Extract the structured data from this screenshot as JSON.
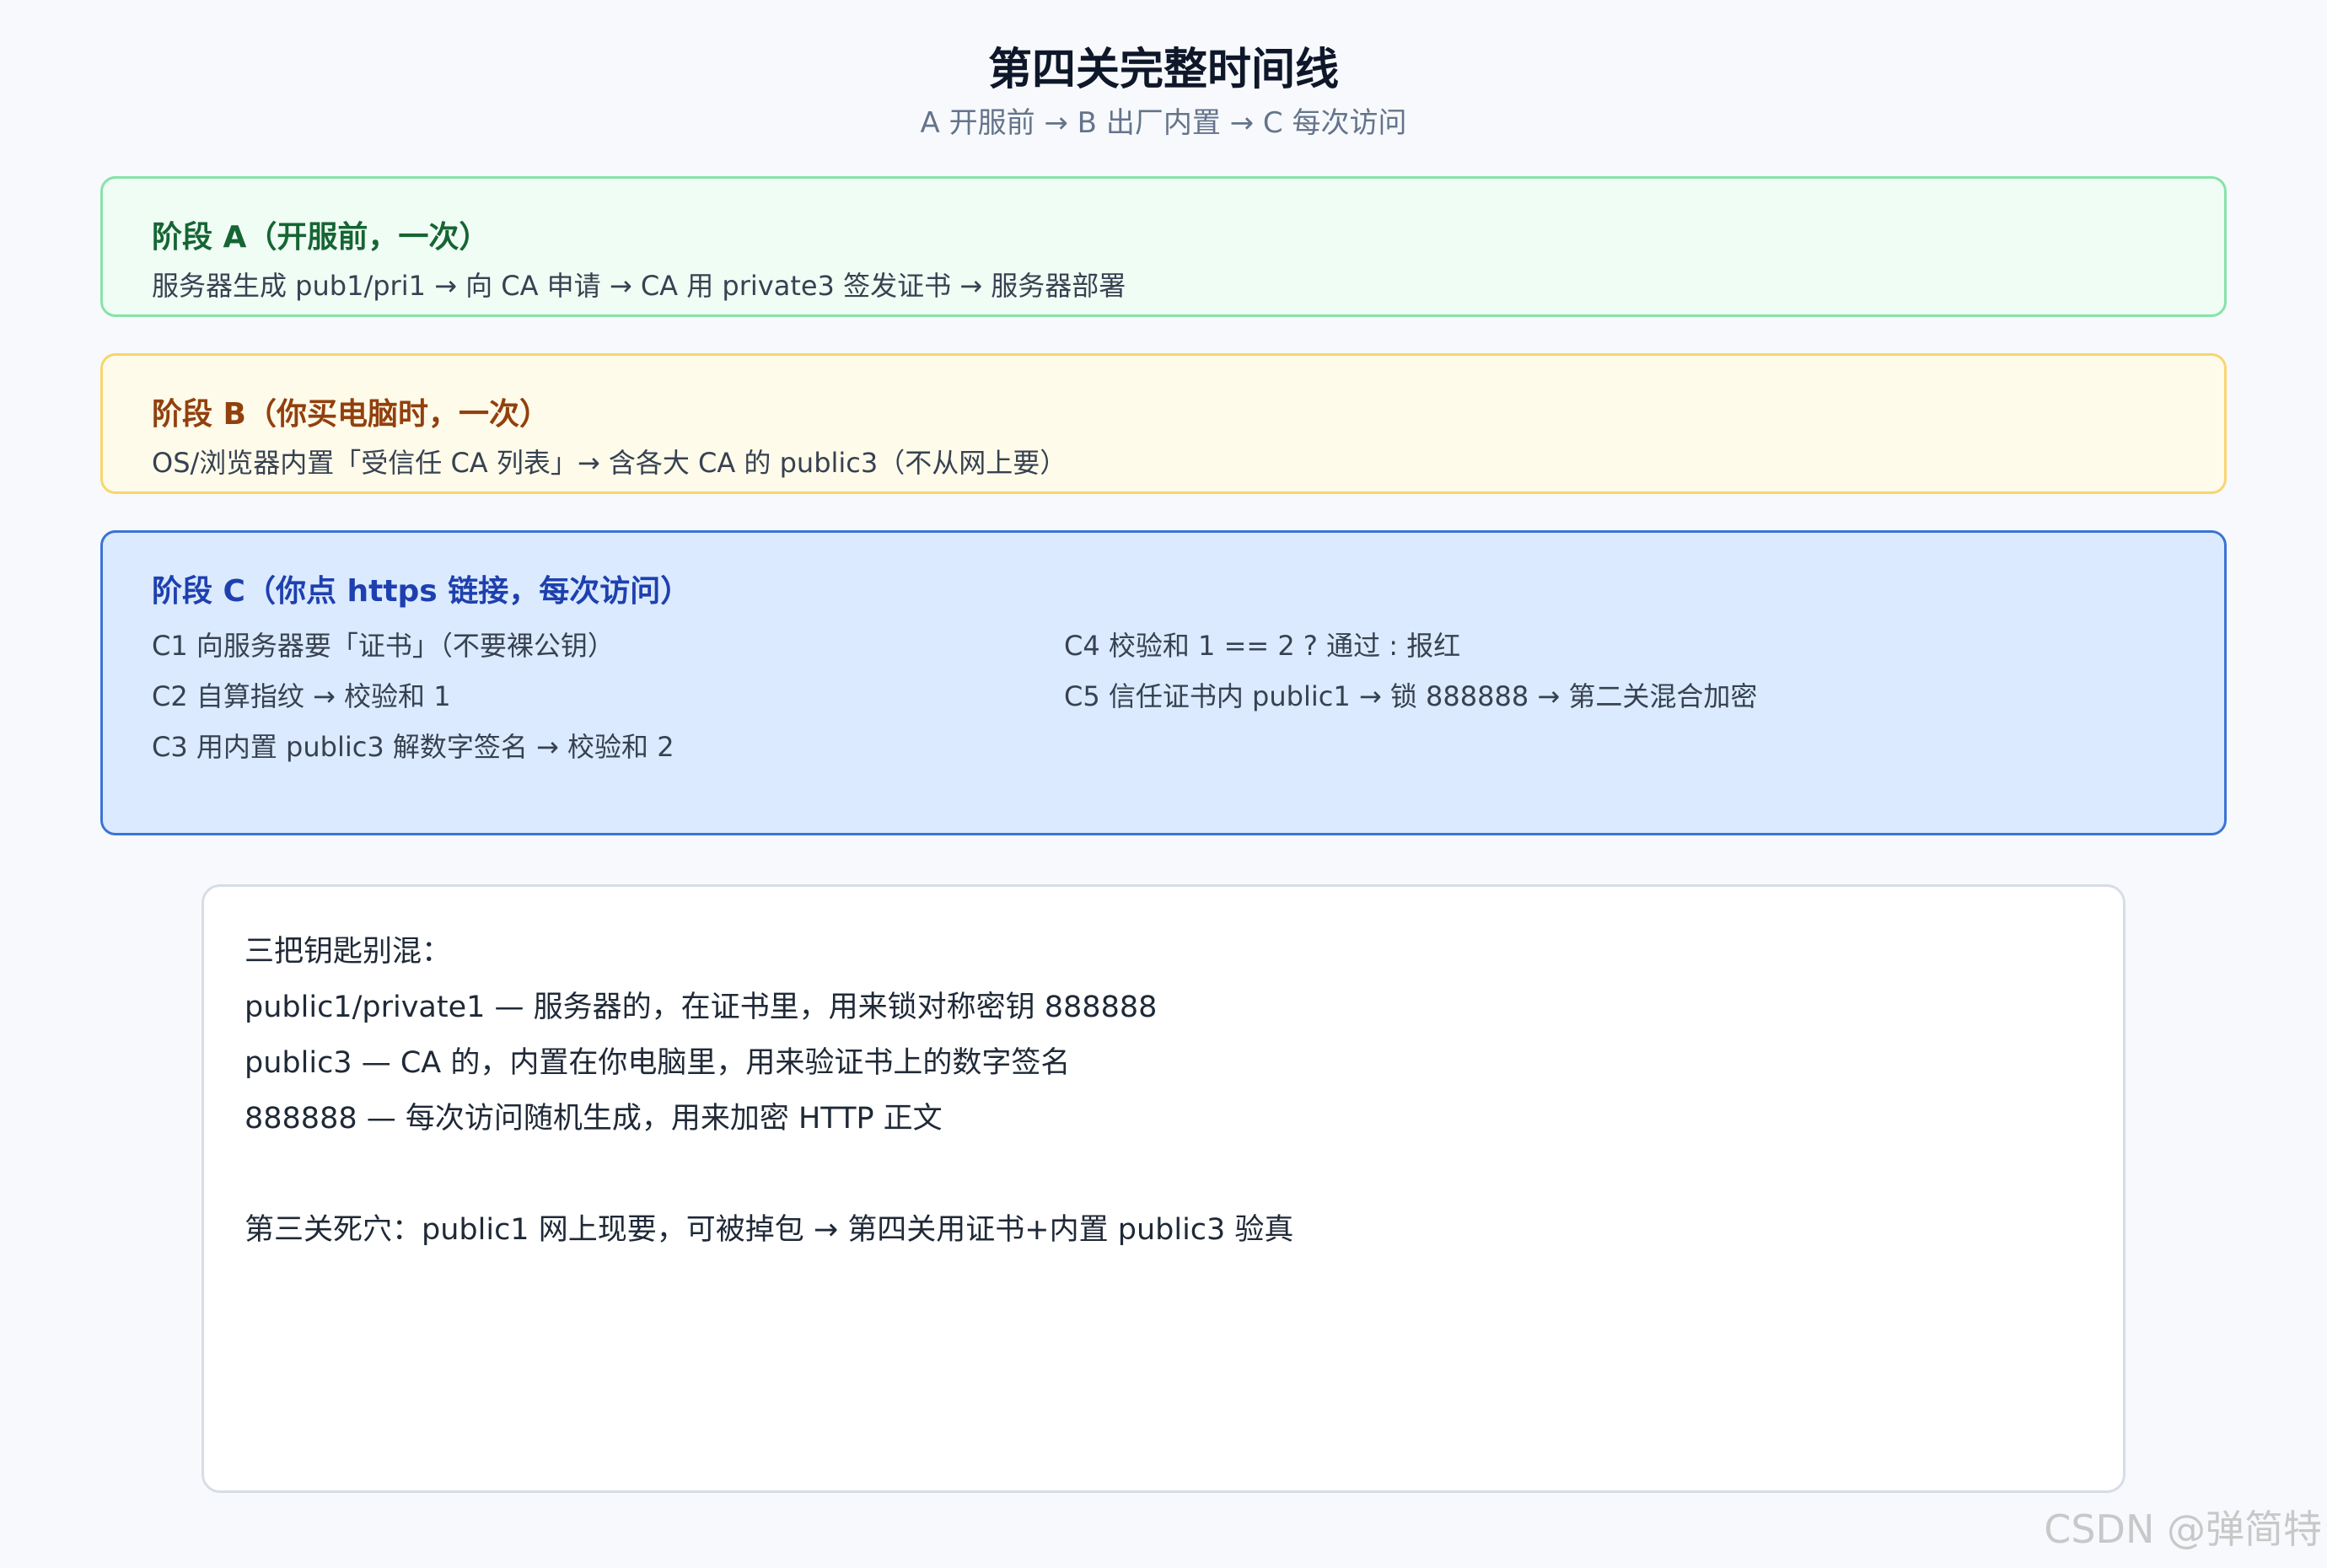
{
  "header": {
    "title": "第四关完整时间线",
    "subtitle": "A 开服前 → B 出厂内置 → C 每次访问"
  },
  "stages": {
    "a": {
      "title": "阶段 A（开服前，一次）",
      "description": "服务器生成 pub1/pri1 → 向 CA 申请 → CA 用 private3 签发证书 → 服务器部署"
    },
    "b": {
      "title": "阶段 B（你买电脑时，一次）",
      "description": "OS/浏览器内置「受信任 CA 列表」→ 含各大 CA 的 public3（不从网上要）"
    },
    "c": {
      "title": "阶段 C（你点 https 链接，每次访问）",
      "steps": [
        "C1 向服务器要「证书」（不要裸公钥）",
        "C2 自算指纹 → 校验和 1",
        "C3 用内置 public3 解数字签名 → 校验和 2",
        "C4 校验和 1 == 2 ? 通过 : 报红",
        "C5 信任证书内 public1 → 锁 888888 → 第二关混合加密"
      ]
    }
  },
  "keys_note": {
    "lines": [
      "三把钥匙别混：",
      "public1/private1 — 服务器的，在证书里，用来锁对称密钥 888888",
      "public3 — CA 的，内置在你电脑里，用来验证书上的数字签名",
      "888888 — 每次访问随机生成，用来加密 HTTP 正文",
      "第三关死穴：public1 网上现要，可被掉包 → 第四关用证书+内置 public3 验真"
    ]
  },
  "watermark": "CSDN @弹简特",
  "colors": {
    "stage_a_border": "#86e3a8",
    "stage_a_bg": "#effdf4",
    "stage_a_title": "#166534",
    "stage_b_border": "#f7d66e",
    "stage_b_bg": "#fefbea",
    "stage_b_title": "#92400e",
    "stage_c_border": "#3b73d6",
    "stage_c_bg": "#dbeafe",
    "stage_c_title": "#1e40af"
  }
}
